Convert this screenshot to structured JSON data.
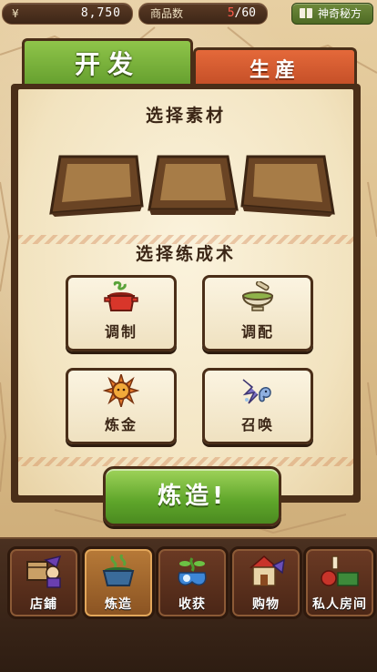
{
  "status_bar": {
    "currency_symbol": "¥",
    "money": "8,750",
    "goods_label": "商品数",
    "goods_current": "5",
    "goods_max": "/60",
    "secret_label": "神奇秘方"
  },
  "tabs": {
    "development": "开发",
    "production": "生産"
  },
  "panel": {
    "materials_title": "选择素材",
    "alchemy_title": "选择练成术",
    "skills": [
      {
        "label": "调制",
        "icon": "pot-icon"
      },
      {
        "label": "调配",
        "icon": "mortar-icon"
      },
      {
        "label": "炼金",
        "icon": "sun-icon"
      },
      {
        "label": "召唤",
        "icon": "spirit-icon"
      }
    ],
    "forge_button": "炼造!"
  },
  "bottom_nav": [
    {
      "label": "店鋪",
      "icon": "shop-icon",
      "active": false
    },
    {
      "label": "炼造",
      "icon": "cauldron-icon",
      "active": true
    },
    {
      "label": "收获",
      "icon": "harvest-icon",
      "active": false
    },
    {
      "label": "购物",
      "icon": "market-icon",
      "active": false
    },
    {
      "label": "私人房间",
      "icon": "room-icon",
      "active": false
    }
  ],
  "colors": {
    "accent_green": "#5f9a2a",
    "accent_red": "#bf4a24",
    "frame_brown": "#4a2e18",
    "goods_current": "#ff5b4c"
  }
}
